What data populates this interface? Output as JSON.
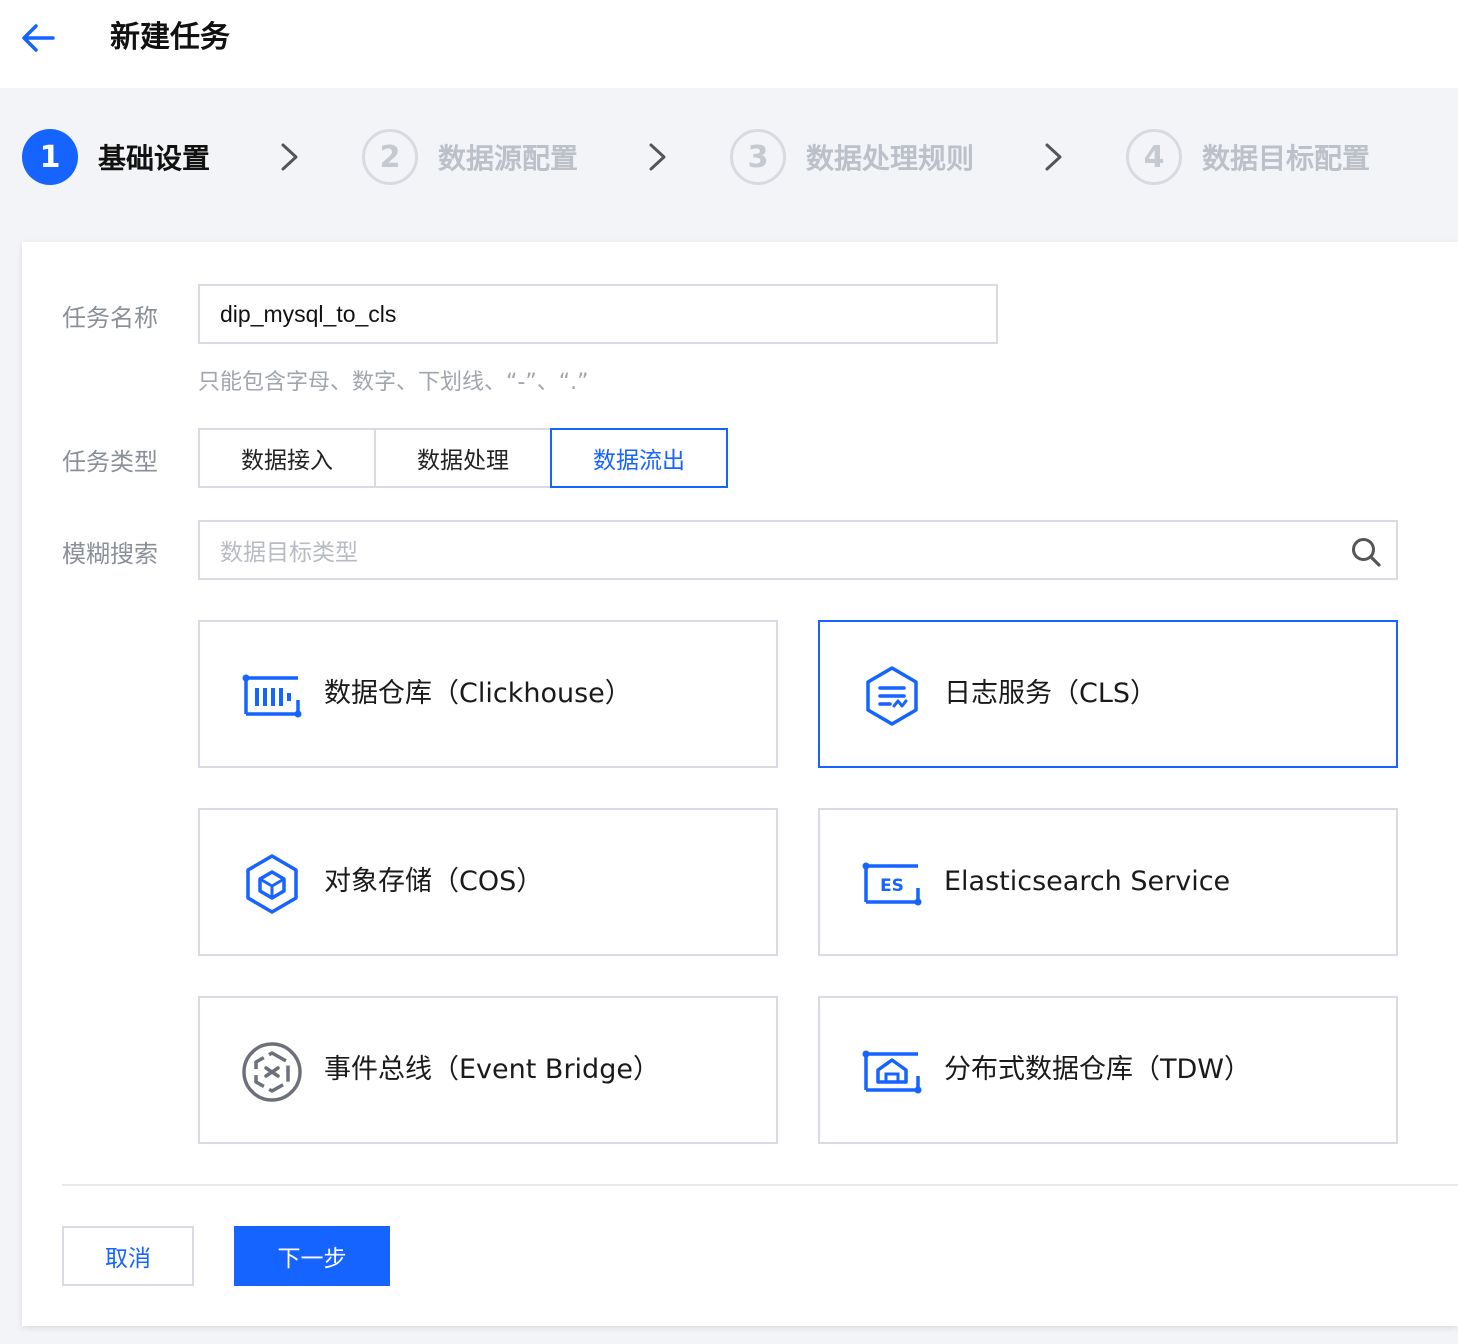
{
  "header": {
    "back_icon": "arrow-left-icon",
    "title": "新建任务"
  },
  "steps": [
    {
      "number": "1",
      "label": "基础设置",
      "state": "active"
    },
    {
      "number": "2",
      "label": "数据源配置",
      "state": "inactive"
    },
    {
      "number": "3",
      "label": "数据处理规则",
      "state": "inactive"
    },
    {
      "number": "4",
      "label": "数据目标配置",
      "state": "inactive"
    }
  ],
  "form": {
    "task_name": {
      "label": "任务名称",
      "value": "dip_mysql_to_cls",
      "hint": "只能包含字母、数字、下划线、“-”、“.”"
    },
    "task_type": {
      "label": "任务类型",
      "options": [
        "数据接入",
        "数据处理",
        "数据流出"
      ],
      "selected": "数据流出"
    },
    "search": {
      "label": "模糊搜索",
      "placeholder": "数据目标类型"
    }
  },
  "targets": [
    {
      "label": "数据仓库（Clickhouse）",
      "icon": "clickhouse-icon",
      "selected": false
    },
    {
      "label": "日志服务（CLS）",
      "icon": "cls-icon",
      "selected": true
    },
    {
      "label": "对象存储（COS）",
      "icon": "cos-icon",
      "selected": false
    },
    {
      "label": "Elasticsearch Service",
      "icon": "elasticsearch-icon",
      "selected": false
    },
    {
      "label": "事件总线（Event Bridge）",
      "icon": "eventbridge-icon",
      "selected": false
    },
    {
      "label": "分布式数据仓库（TDW）",
      "icon": "tdw-icon",
      "selected": false
    }
  ],
  "actions": {
    "cancel": "取消",
    "next": "下一步"
  },
  "colors": {
    "primary": "#1664ff",
    "border": "#d8dbe1",
    "muted_text": "#8a8f99",
    "inactive_step": "#bcc0c8",
    "page_bg": "#f3f4f7"
  }
}
